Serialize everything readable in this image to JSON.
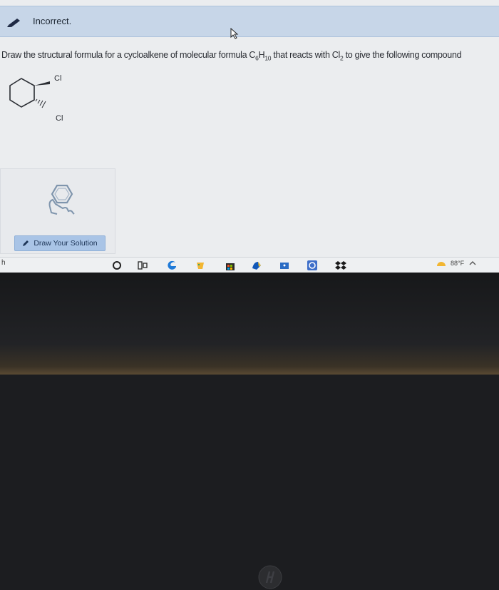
{
  "feedback": {
    "status": "Incorrect."
  },
  "question": {
    "text_before_formula": "Draw the structural formula for a cycloalkene of molecular formula C",
    "sub_1": "6",
    "mid_1": "H",
    "sub_2": "10",
    "text_after_formula": " that reacts with Cl",
    "sub_3": "2",
    "text_end": " to give the following compound"
  },
  "molecule": {
    "label_top": "Cl",
    "label_bottom": "Cl"
  },
  "sketch": {
    "button_label": "Draw Your Solution"
  },
  "taskbar": {
    "left_text": "h",
    "temperature": "88°F"
  },
  "colors": {
    "feedback_bg": "#c7d6e8",
    "button_bg": "#a9c4e6",
    "accent": "#2b6cc4"
  }
}
